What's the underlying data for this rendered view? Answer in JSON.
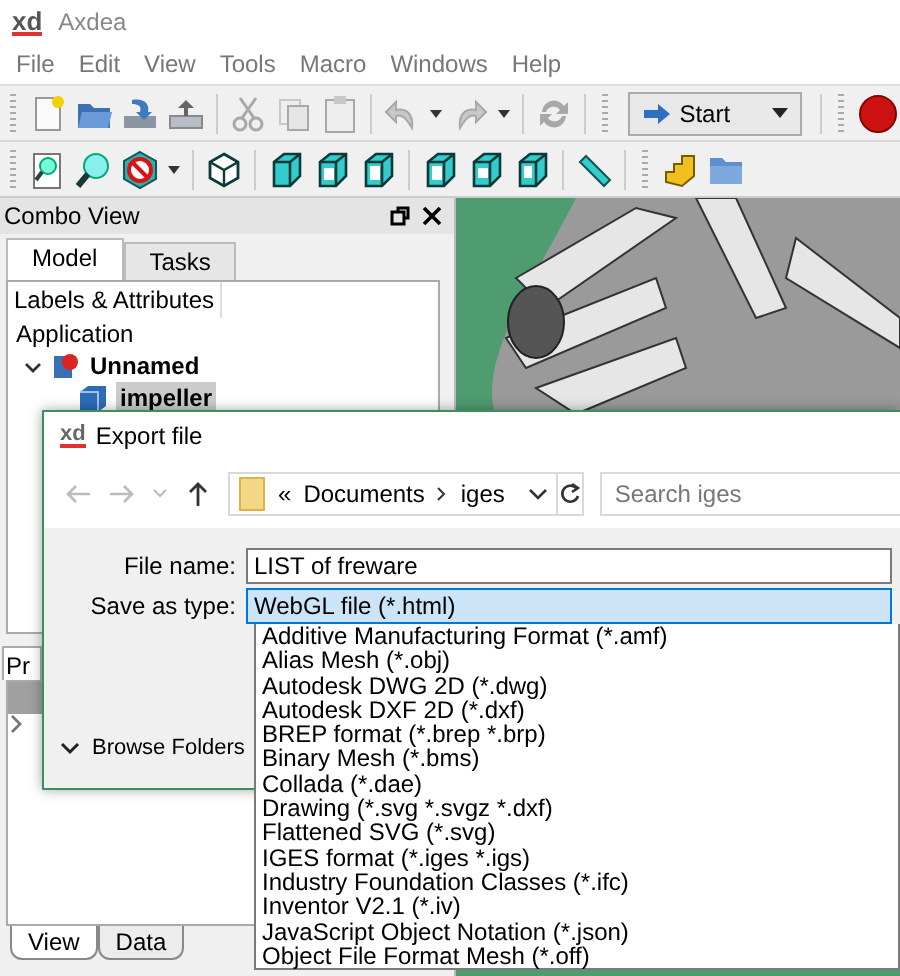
{
  "window": {
    "logo": "xd",
    "title": "Axdea"
  },
  "menu": [
    "File",
    "Edit",
    "View",
    "Tools",
    "Macro",
    "Windows",
    "Help"
  ],
  "toolbar": {
    "workbench": "Start"
  },
  "combo_view": {
    "title": "Combo View",
    "tabs": [
      {
        "label": "Model",
        "selected": true
      },
      {
        "label": "Tasks",
        "selected": false
      }
    ],
    "tree_header": "Labels & Attributes",
    "tree": [
      {
        "label": "Application",
        "kind": "root",
        "children": [
          {
            "label": "Unnamed",
            "kind": "document",
            "expanded": true,
            "selected": false,
            "children": [
              {
                "label": "impeller",
                "kind": "part",
                "selected": true
              }
            ]
          }
        ]
      }
    ]
  },
  "property_view": {
    "tab": "Pr",
    "bottom_tabs": [
      {
        "label": "View",
        "selected": true
      },
      {
        "label": "Data",
        "selected": false
      }
    ]
  },
  "dialog": {
    "logo": "xd",
    "title": "Export file",
    "path": {
      "overflow": "«",
      "segments": [
        "Documents",
        "iges"
      ]
    },
    "search": {
      "placeholder": "Search iges"
    },
    "file_name": {
      "label": "File name:",
      "value": "LIST of freware"
    },
    "save_type": {
      "label": "Save as type:",
      "value": "WebGL file (*.html)",
      "expanded": true,
      "options": [
        {
          "label": "Additive Manufacturing Format (*.amf)",
          "selected": false
        },
        {
          "label": "Alias Mesh (*.obj)",
          "selected": false
        },
        {
          "label": "Autodesk DWG 2D (*.dwg)",
          "selected": false
        },
        {
          "label": "Autodesk DXF 2D (*.dxf)",
          "selected": false
        },
        {
          "label": "BREP format (*.brep *.brp)",
          "selected": false
        },
        {
          "label": "Binary Mesh (*.bms)",
          "selected": false
        },
        {
          "label": "Collada (*.dae)",
          "selected": false
        },
        {
          "label": "Drawing (*.svg *.svgz *.dxf)",
          "selected": false
        },
        {
          "label": "Flattened SVG (*.svg)",
          "selected": false
        },
        {
          "label": "IGES format (*.iges *.igs)",
          "selected": false
        },
        {
          "label": "Industry Foundation Classes (*.ifc)",
          "selected": false
        },
        {
          "label": "Inventor V2.1 (*.iv)",
          "selected": false
        },
        {
          "label": "JavaScript Object Notation (*.json)",
          "selected": false
        },
        {
          "label": "Object File Format Mesh (*.off)",
          "selected": false
        }
      ]
    },
    "browse_folders": "Browse Folders"
  }
}
